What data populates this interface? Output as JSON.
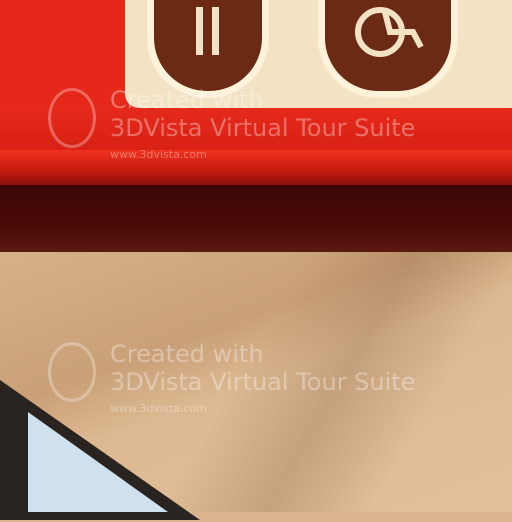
{
  "watermarks": [
    {
      "line1": "Created with",
      "line2": "3DVista Virtual Tour Suite",
      "url": "www.3dvista.com"
    },
    {
      "line1": "Created with",
      "line2": "3DVista Virtual Tour Suite",
      "url": "www.3dvista.com"
    }
  ],
  "sign": {
    "icons": [
      "toilet-icon",
      "wheelchair-icon"
    ]
  },
  "colors": {
    "sign_red": "#e5281a",
    "sign_cream": "#f3e2c4",
    "icon_brown": "#6a2a14",
    "ceiling": "#d9b48e"
  }
}
